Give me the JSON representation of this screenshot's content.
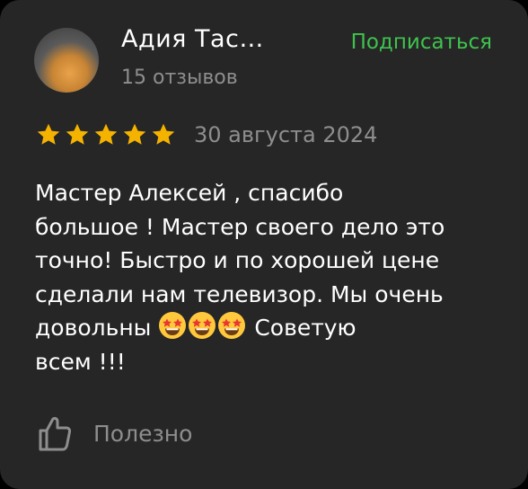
{
  "author": {
    "name": "Адия Тас…",
    "reviews_count": "15 отзывов"
  },
  "subscribe_label": "Подписаться",
  "rating": {
    "value": 5,
    "max": 5
  },
  "date": "30 августа 2024",
  "review": {
    "lines": [
      "Мастер Алексей , спасибо",
      "большое ! Мастер своего дело это",
      "точно! Быстро и по хорошей цене",
      "сделали нам телевизор. Мы очень",
      "довольны",
      "Советую",
      "всем !!!"
    ],
    "emojis": [
      "star-struck-emoji",
      "star-struck-emoji",
      "star-struck-emoji"
    ]
  },
  "helpful_label": "Полезно",
  "colors": {
    "background": "#262626",
    "accent_green": "#3fc24e",
    "star_gold": "#f5b300",
    "muted_text": "#8e8e8e"
  }
}
